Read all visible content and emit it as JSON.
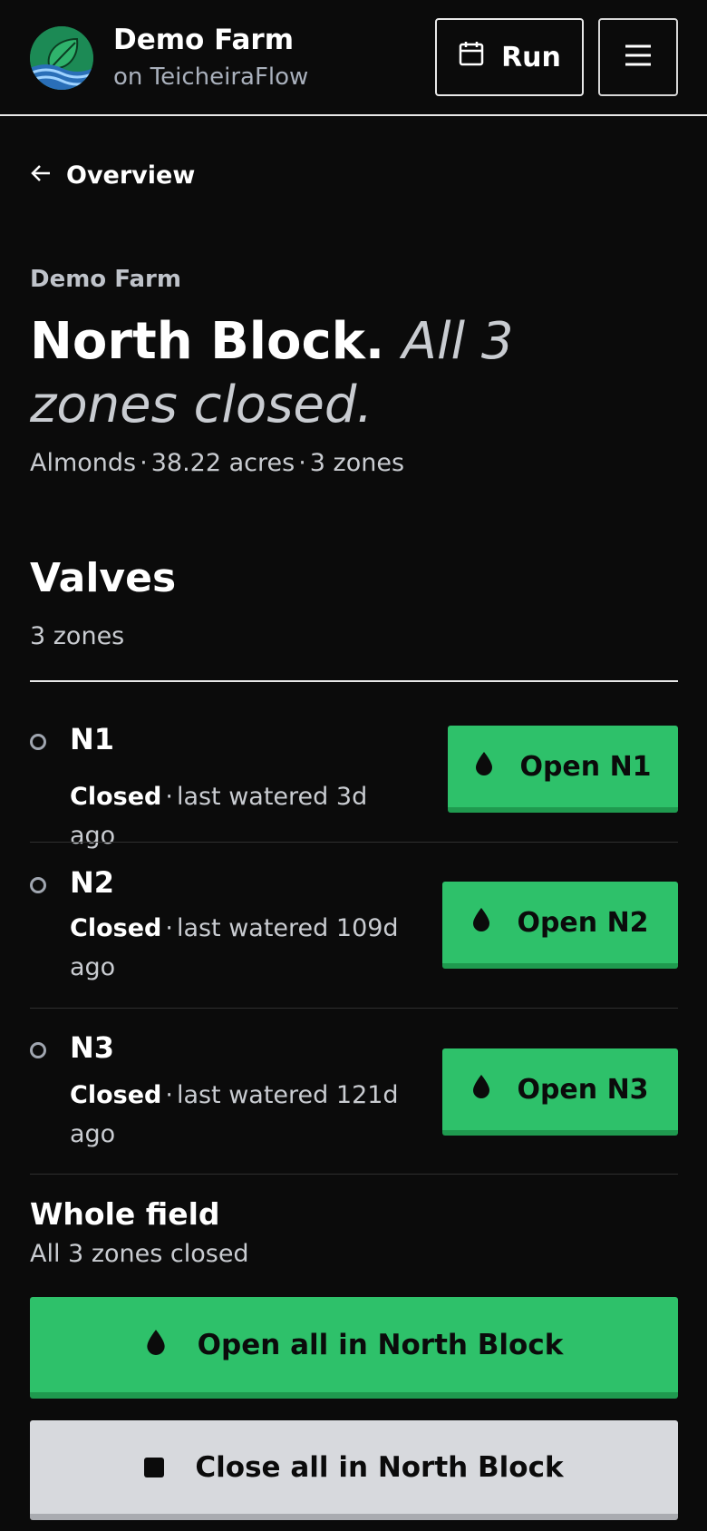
{
  "header": {
    "brand_name": "Demo Farm",
    "brand_sub": "on TeicheiraFlow",
    "run_label": "Run"
  },
  "nav": {
    "back_label": "Overview"
  },
  "block": {
    "farm": "Demo Farm",
    "name": "North Block.",
    "status": "All 3 zones closed.",
    "crop": "Almonds",
    "acres": "38.22 acres",
    "zones": "3 zones",
    "separator": "·"
  },
  "valves": {
    "title": "Valves",
    "count": "3 zones",
    "items": [
      {
        "name": "N1",
        "state": "Closed",
        "detail": "last watered 3d ago",
        "button": "Open N1"
      },
      {
        "name": "N2",
        "state": "Closed",
        "detail": "last watered 109d ago",
        "button": "Open N2"
      },
      {
        "name": "N3",
        "state": "Closed",
        "detail": "last watered 121d ago",
        "button": "Open N3"
      }
    ]
  },
  "whole_field": {
    "title": "Whole field",
    "status": "All 3 zones closed",
    "open_all": "Open all in North Block",
    "close_all": "Close all in North Block"
  },
  "colors": {
    "background": "#0b0b0b",
    "accent_green": "#2ec16a",
    "muted_text": "#c9ccd1",
    "close_button": "#d7d9dd"
  },
  "icons": {
    "logo": "leaf-water-logo",
    "run": "calendar-icon",
    "menu": "hamburger-menu-icon",
    "back": "arrow-left-icon",
    "open": "water-drop-icon",
    "close": "stop-square-icon",
    "zone_state": "status-ring-icon"
  }
}
